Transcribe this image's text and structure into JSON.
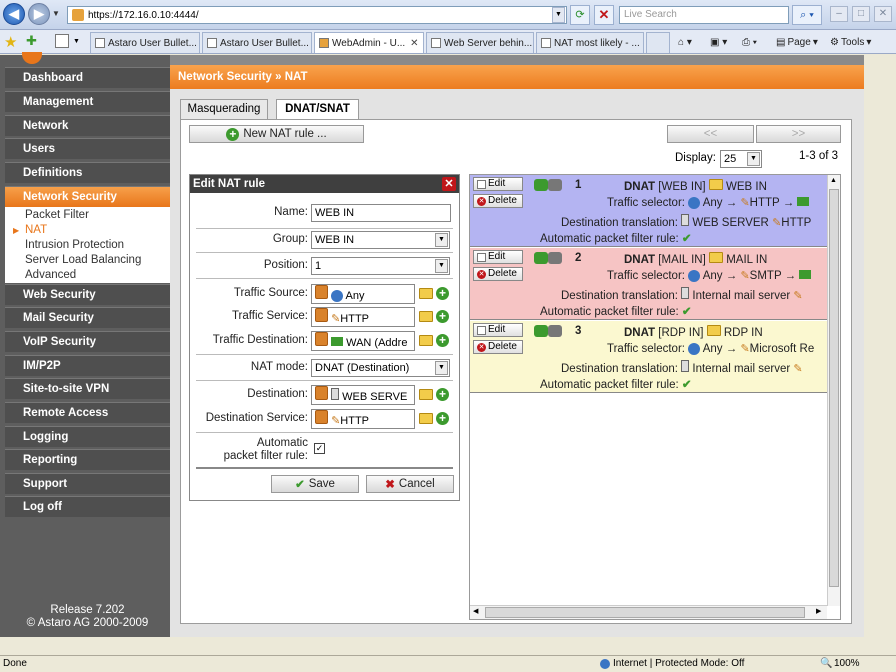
{
  "browser": {
    "url": "https://172.16.0.10:4444/",
    "search_placeholder": "Live Search",
    "tabs": [
      {
        "label": "Astaro User Bullet..."
      },
      {
        "label": "Astaro User Bullet..."
      },
      {
        "label": "WebAdmin - U..."
      },
      {
        "label": "Web Server behin..."
      },
      {
        "label": "NAT most likely - ..."
      }
    ],
    "toolbar": {
      "page_label": "Page",
      "tools_label": "Tools"
    },
    "status_left": "Done",
    "zone": "Internet | Protected Mode: Off",
    "zoom": "100%"
  },
  "sidebar": {
    "items": [
      {
        "label": "Dashboard"
      },
      {
        "label": "Management"
      },
      {
        "label": "Network"
      },
      {
        "label": "Users"
      },
      {
        "label": "Definitions"
      },
      {
        "label": "Network Security"
      },
      {
        "label": "Web Security"
      },
      {
        "label": "Mail Security"
      },
      {
        "label": "VoIP Security"
      },
      {
        "label": "IM/P2P"
      },
      {
        "label": "Site-to-site VPN"
      },
      {
        "label": "Remote Access"
      },
      {
        "label": "Logging"
      },
      {
        "label": "Reporting"
      },
      {
        "label": "Support"
      },
      {
        "label": "Log off"
      }
    ],
    "subitems": [
      {
        "label": "Packet Filter"
      },
      {
        "label": "NAT"
      },
      {
        "label": "Intrusion Protection"
      },
      {
        "label": "Server Load Balancing"
      },
      {
        "label": "Advanced"
      }
    ],
    "release": "Release 7.202",
    "copyright": "© Astaro AG 2000-2009"
  },
  "breadcrumb": "Network Security » NAT",
  "tabs": [
    {
      "label": "Masquerading"
    },
    {
      "label": "DNAT/SNAT"
    }
  ],
  "new_rule_label": "New NAT rule ...",
  "pager": {
    "prev": "<<",
    "next": ">>",
    "display_label": "Display:",
    "display_value": "25",
    "count": "1-3 of 3"
  },
  "edit": {
    "title": "Edit NAT rule",
    "name_label": "Name:",
    "name_value": "WEB IN",
    "group_label": "Group:",
    "group_value": "WEB IN",
    "position_label": "Position:",
    "position_value": "1",
    "source_label": "Traffic Source:",
    "source_value": "Any",
    "service_label": "Traffic Service:",
    "service_value": "HTTP",
    "destination_label": "Traffic Destination:",
    "destination_value": "WAN (Addre",
    "mode_label": "NAT mode:",
    "mode_value": "DNAT (Destination)",
    "dest_label": "Destination:",
    "dest_value": "WEB SERVE",
    "dest_service_label": "Destination Service:",
    "dest_service_value": "HTTP",
    "auto_label_1": "Automatic",
    "auto_label_2": "packet filter rule:",
    "save_label": "Save",
    "cancel_label": "Cancel"
  },
  "rules": [
    {
      "num": "1",
      "type": "DNAT",
      "tag": "[WEB IN]",
      "group": "WEB IN",
      "sel_src": "Any",
      "sel_svc": "HTTP",
      "dest_trans": "WEB SERVER",
      "dest_svc": "HTTP",
      "color": "#b4b4f2"
    },
    {
      "num": "2",
      "type": "DNAT",
      "tag": "[MAIL IN]",
      "group": "MAIL IN",
      "sel_src": "Any",
      "sel_svc": "SMTP",
      "dest_trans": "Internal mail server",
      "dest_svc": "",
      "color": "#f6c4c4"
    },
    {
      "num": "3",
      "type": "DNAT",
      "tag": "[RDP IN]",
      "group": "RDP IN",
      "sel_src": "Any",
      "sel_svc": "Microsoft Re",
      "dest_trans": "Internal mail server",
      "dest_svc": "",
      "color": "#fbf8d0"
    }
  ],
  "rule_labels": {
    "edit": "Edit",
    "delete": "Delete",
    "traffic_selector": "Traffic selector:",
    "dest_translation": "Destination translation:",
    "auto_pf": "Automatic packet filter rule:"
  }
}
